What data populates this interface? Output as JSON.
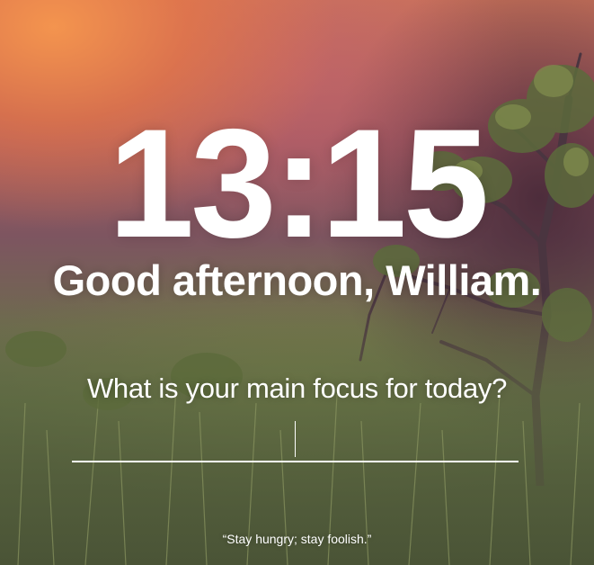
{
  "clock": {
    "time": "13:15"
  },
  "greeting": {
    "text": "Good afternoon, William."
  },
  "focus": {
    "question": "What is your main focus for today?",
    "input_value": ""
  },
  "quote": {
    "text": "“Stay hungry; stay foolish.”"
  },
  "background": {
    "description_colors": {
      "warm_top": "#f6964e",
      "mauve": "#a45a63",
      "grass": "#5d6a45",
      "dark_tree": "#46303a"
    }
  }
}
